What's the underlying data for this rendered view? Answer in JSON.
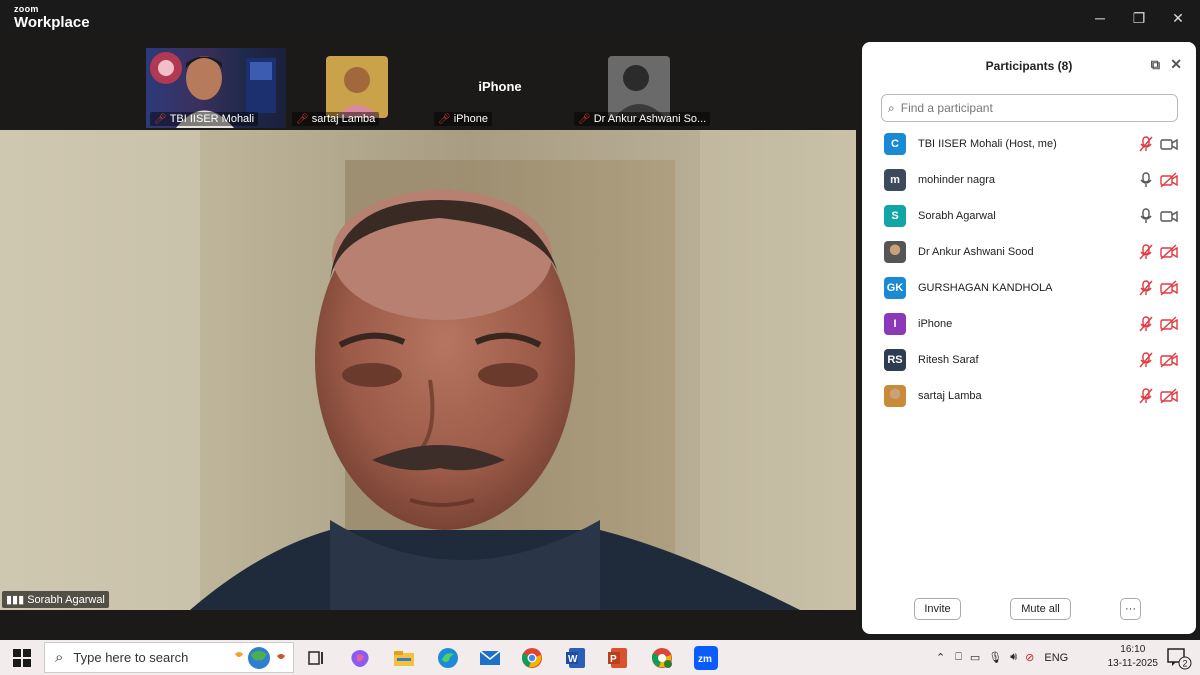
{
  "app": {
    "brand_small": "zoom",
    "brand_big": "Workplace"
  },
  "window_controls": {
    "minimize": "─",
    "restore": "❐",
    "close": "✕"
  },
  "thumbnails": [
    {
      "name": "TBI IISER Mohali",
      "type": "video"
    },
    {
      "name": "sartaj Lamba",
      "type": "avatar"
    },
    {
      "name": "iPhone",
      "type": "name",
      "center_name": "iPhone"
    },
    {
      "name": "Dr Ankur Ashwani So...",
      "type": "avatar"
    }
  ],
  "speaker": {
    "name": "Sorabh Agarwal"
  },
  "panel": {
    "title": "Participants (8)",
    "search_placeholder": "Find a participant",
    "participants": [
      {
        "name": "TBI IISER Mohali (Host, me)",
        "initials": "C",
        "color": "#1a8ad4",
        "mic": "muted",
        "cam": "on"
      },
      {
        "name": "mohinder nagra",
        "initials": "m",
        "color": "#3d4a5c",
        "mic": "on",
        "cam": "off"
      },
      {
        "name": "Sorabh Agarwal",
        "initials": "S",
        "color": "#12a5a5",
        "mic": "on",
        "cam": "on"
      },
      {
        "name": "Dr Ankur Ashwani Sood",
        "initials": "",
        "color": "#555555",
        "mic": "muted",
        "cam": "off"
      },
      {
        "name": "GURSHAGAN KANDHOLA",
        "initials": "GK",
        "color": "#1a8ad4",
        "mic": "muted",
        "cam": "off"
      },
      {
        "name": "iPhone",
        "initials": "I",
        "color": "#8a3ab9",
        "mic": "muted",
        "cam": "off"
      },
      {
        "name": "Ritesh Saraf",
        "initials": "RS",
        "color": "#2e3b52",
        "mic": "muted",
        "cam": "off"
      },
      {
        "name": "sartaj Lamba",
        "initials": "",
        "color": "#c98a3a",
        "mic": "muted",
        "cam": "off"
      }
    ],
    "invite_label": "Invite",
    "mute_all_label": "Mute all",
    "more_label": "···"
  },
  "taskbar": {
    "search_placeholder": "Type here to search",
    "lang": "ENG",
    "time": "16:10",
    "date": "13-11-2025",
    "notifications": "2"
  },
  "colors": {
    "muted_red": "#e0393e",
    "zoom_blue": "#0b5cff"
  }
}
